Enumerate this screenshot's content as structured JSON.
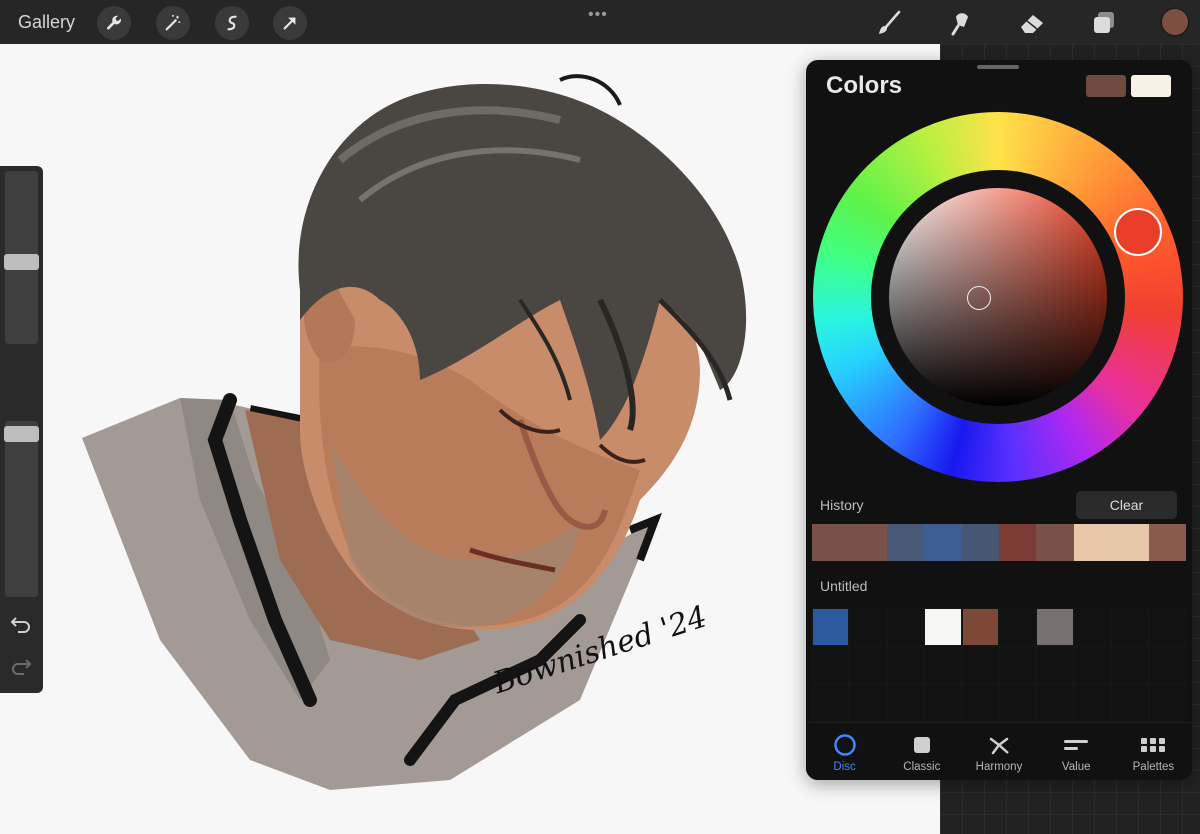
{
  "topbar": {
    "gallery_label": "Gallery",
    "left_tools": [
      "wrench-icon",
      "magic-wand-icon",
      "selection-icon",
      "transform-arrow-icon"
    ],
    "more": "•••",
    "right_tools": [
      "brush-icon",
      "smudge-icon",
      "eraser-icon",
      "layers-icon"
    ],
    "current_color": "#7b5042"
  },
  "canvas": {
    "signature": "Bownished '24"
  },
  "sidebar": {
    "brush_size_level": 0.47,
    "opacity_level": 0.03
  },
  "colors_panel": {
    "title": "Colors",
    "primary_color": "#6e4a3f",
    "secondary_color": "#f8f1e6",
    "history_label": "History",
    "clear_label": "Clear",
    "history": [
      "#7a5146",
      "#7a5146",
      "#4a5877",
      "#3d5d95",
      "#475672",
      "#7c3b35",
      "#7a5146",
      "#e8c8a8",
      "#e7c9aa",
      "#8a5a4c"
    ],
    "palette_label": "Untitled",
    "palette": [
      "#2c5aa0",
      "",
      "",
      "#f7f7f5",
      "#7b4936",
      "",
      "#767070",
      "",
      "",
      ""
    ],
    "tabs": [
      {
        "label": "Disc",
        "active": true
      },
      {
        "label": "Classic",
        "active": false
      },
      {
        "label": "Harmony",
        "active": false
      },
      {
        "label": "Value",
        "active": false
      },
      {
        "label": "Palettes",
        "active": false
      }
    ]
  }
}
